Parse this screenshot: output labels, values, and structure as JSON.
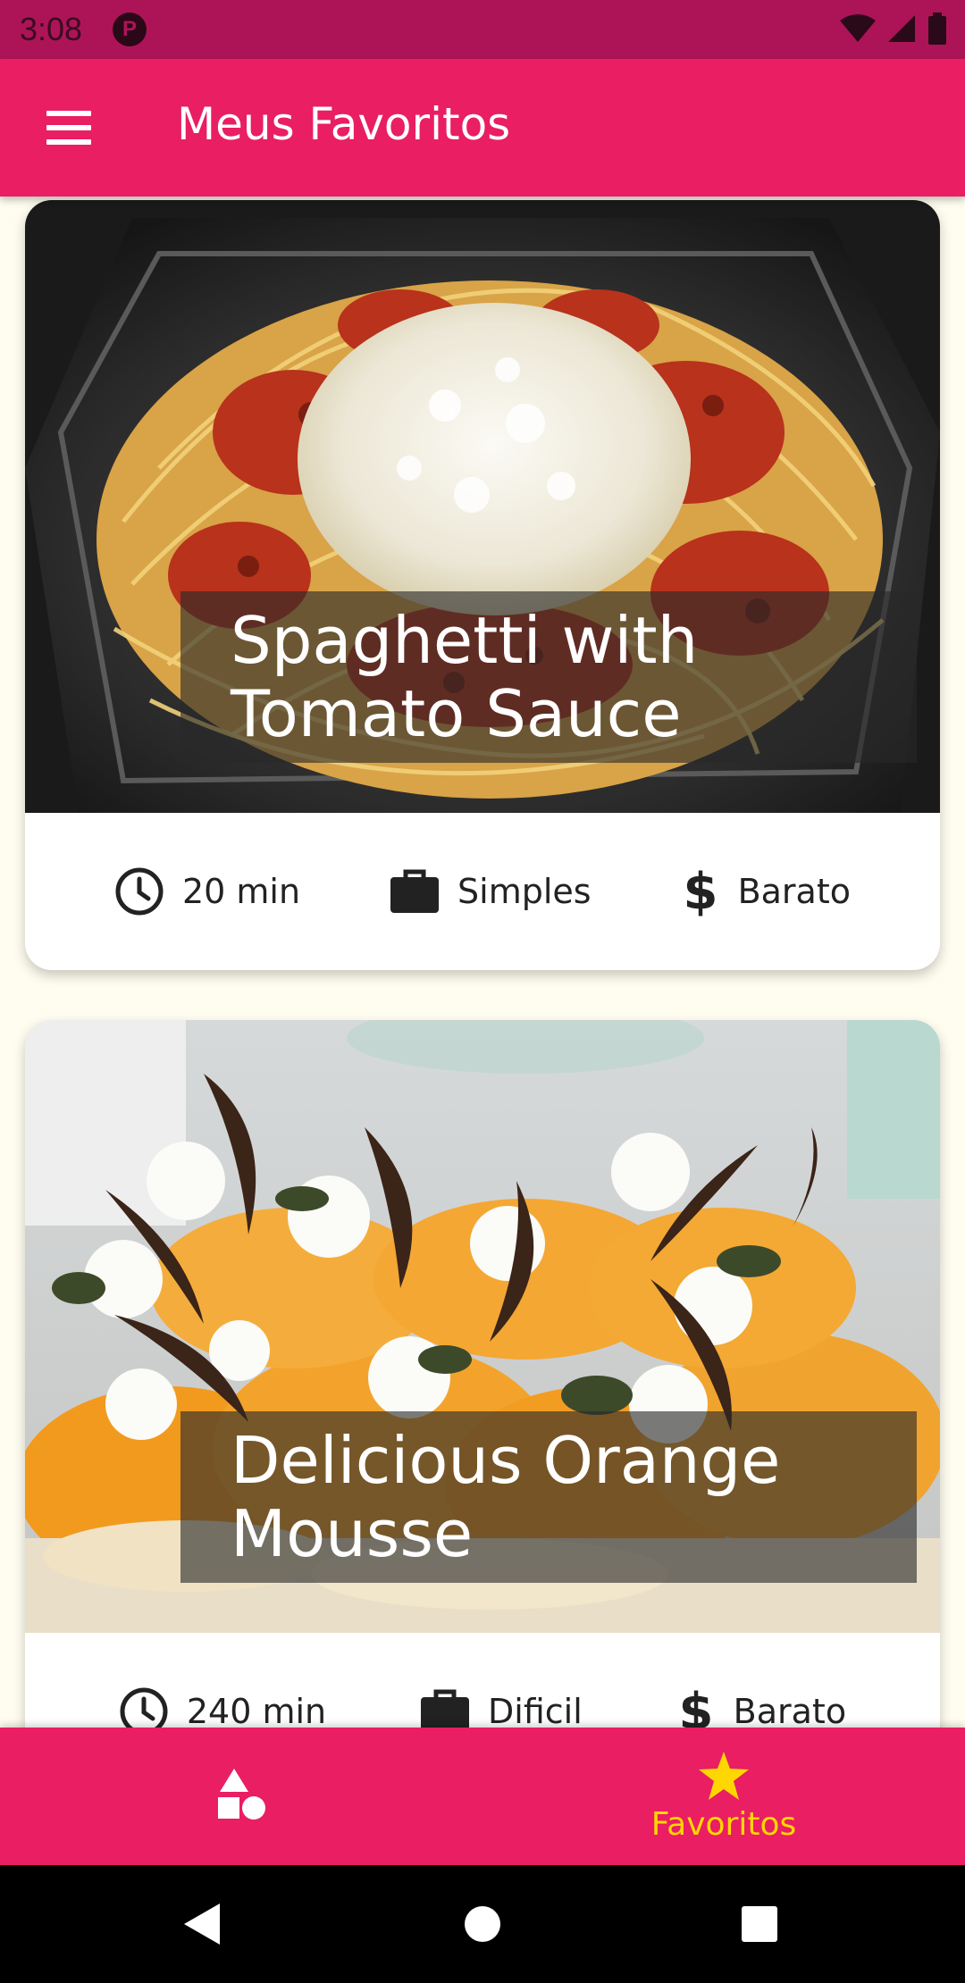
{
  "status_bar": {
    "time": "3:08",
    "notification_glyph": "P"
  },
  "app_bar": {
    "title": "Meus Favoritos",
    "menu_icon": "hamburger-menu-icon"
  },
  "meals": [
    {
      "title_line1": "Spaghetti with",
      "title_line2": "Tomato Sauce",
      "duration": "20 min",
      "complexity": "Simples",
      "cost": "Barato"
    },
    {
      "title_line1": "Delicious Orange",
      "title_line2": "Mousse",
      "duration": "240 min",
      "complexity": "Dificil",
      "cost": "Barato"
    }
  ],
  "bottom_nav": {
    "tabs": [
      {
        "label": "",
        "icon": "categories-icon",
        "selected": false
      },
      {
        "label": "Favoritos",
        "icon": "star-icon",
        "selected": true
      }
    ]
  },
  "colors": {
    "status_bar": "#ad1457",
    "primary": "#e91e63",
    "accent": "#ffd600",
    "background": "#fffdf0"
  }
}
